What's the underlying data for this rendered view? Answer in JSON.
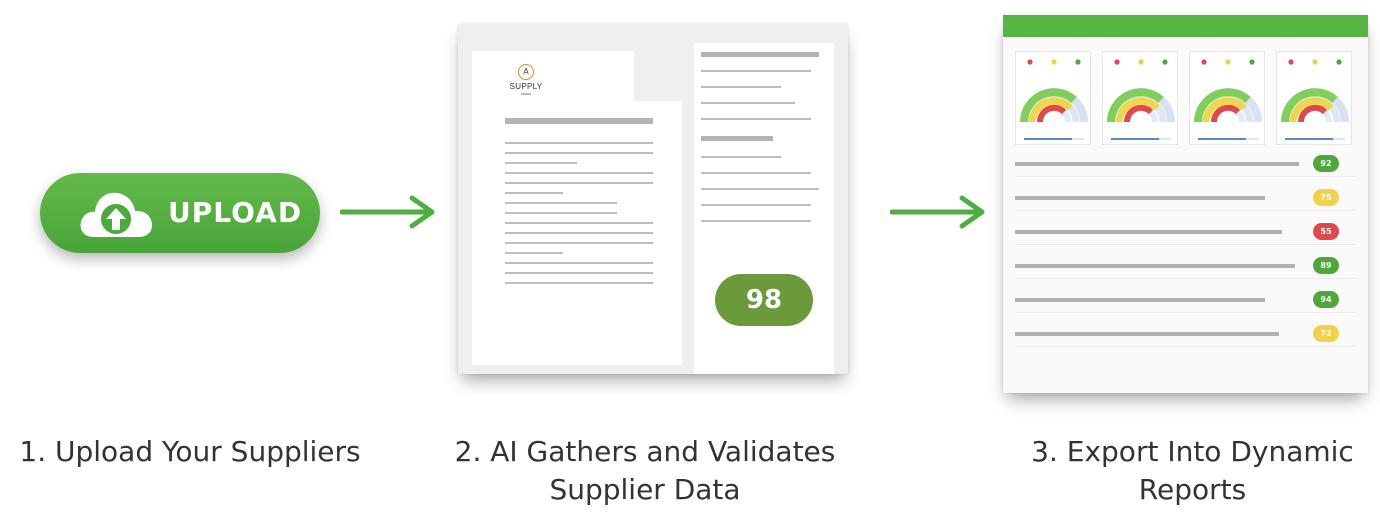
{
  "upload_button": {
    "label": "UPLOAD",
    "icon": "cloud-upload-icon",
    "color": "#57b546"
  },
  "steps": [
    {
      "caption": "1. Upload Your Suppliers"
    },
    {
      "caption": "2. AI Gathers and Validates Supplier Data"
    },
    {
      "caption": "3. Export Into Dynamic Reports"
    }
  ],
  "document": {
    "logo_text": "SUPPLY",
    "logo_mark": "A",
    "score": "98",
    "score_color": "#6a9a3c"
  },
  "report": {
    "header_color": "#57b546",
    "gauge_count": 4,
    "rows": [
      {
        "score": "92",
        "status": "green"
      },
      {
        "score": "75",
        "status": "yellow"
      },
      {
        "score": "55",
        "status": "red"
      },
      {
        "score": "89",
        "status": "green"
      },
      {
        "score": "94",
        "status": "green"
      },
      {
        "score": "72",
        "status": "yellow"
      }
    ],
    "status_colors": {
      "green": "#4fa63b",
      "yellow": "#f3d04a",
      "red": "#e0494b"
    }
  },
  "arrow_color": "#4caf3f"
}
